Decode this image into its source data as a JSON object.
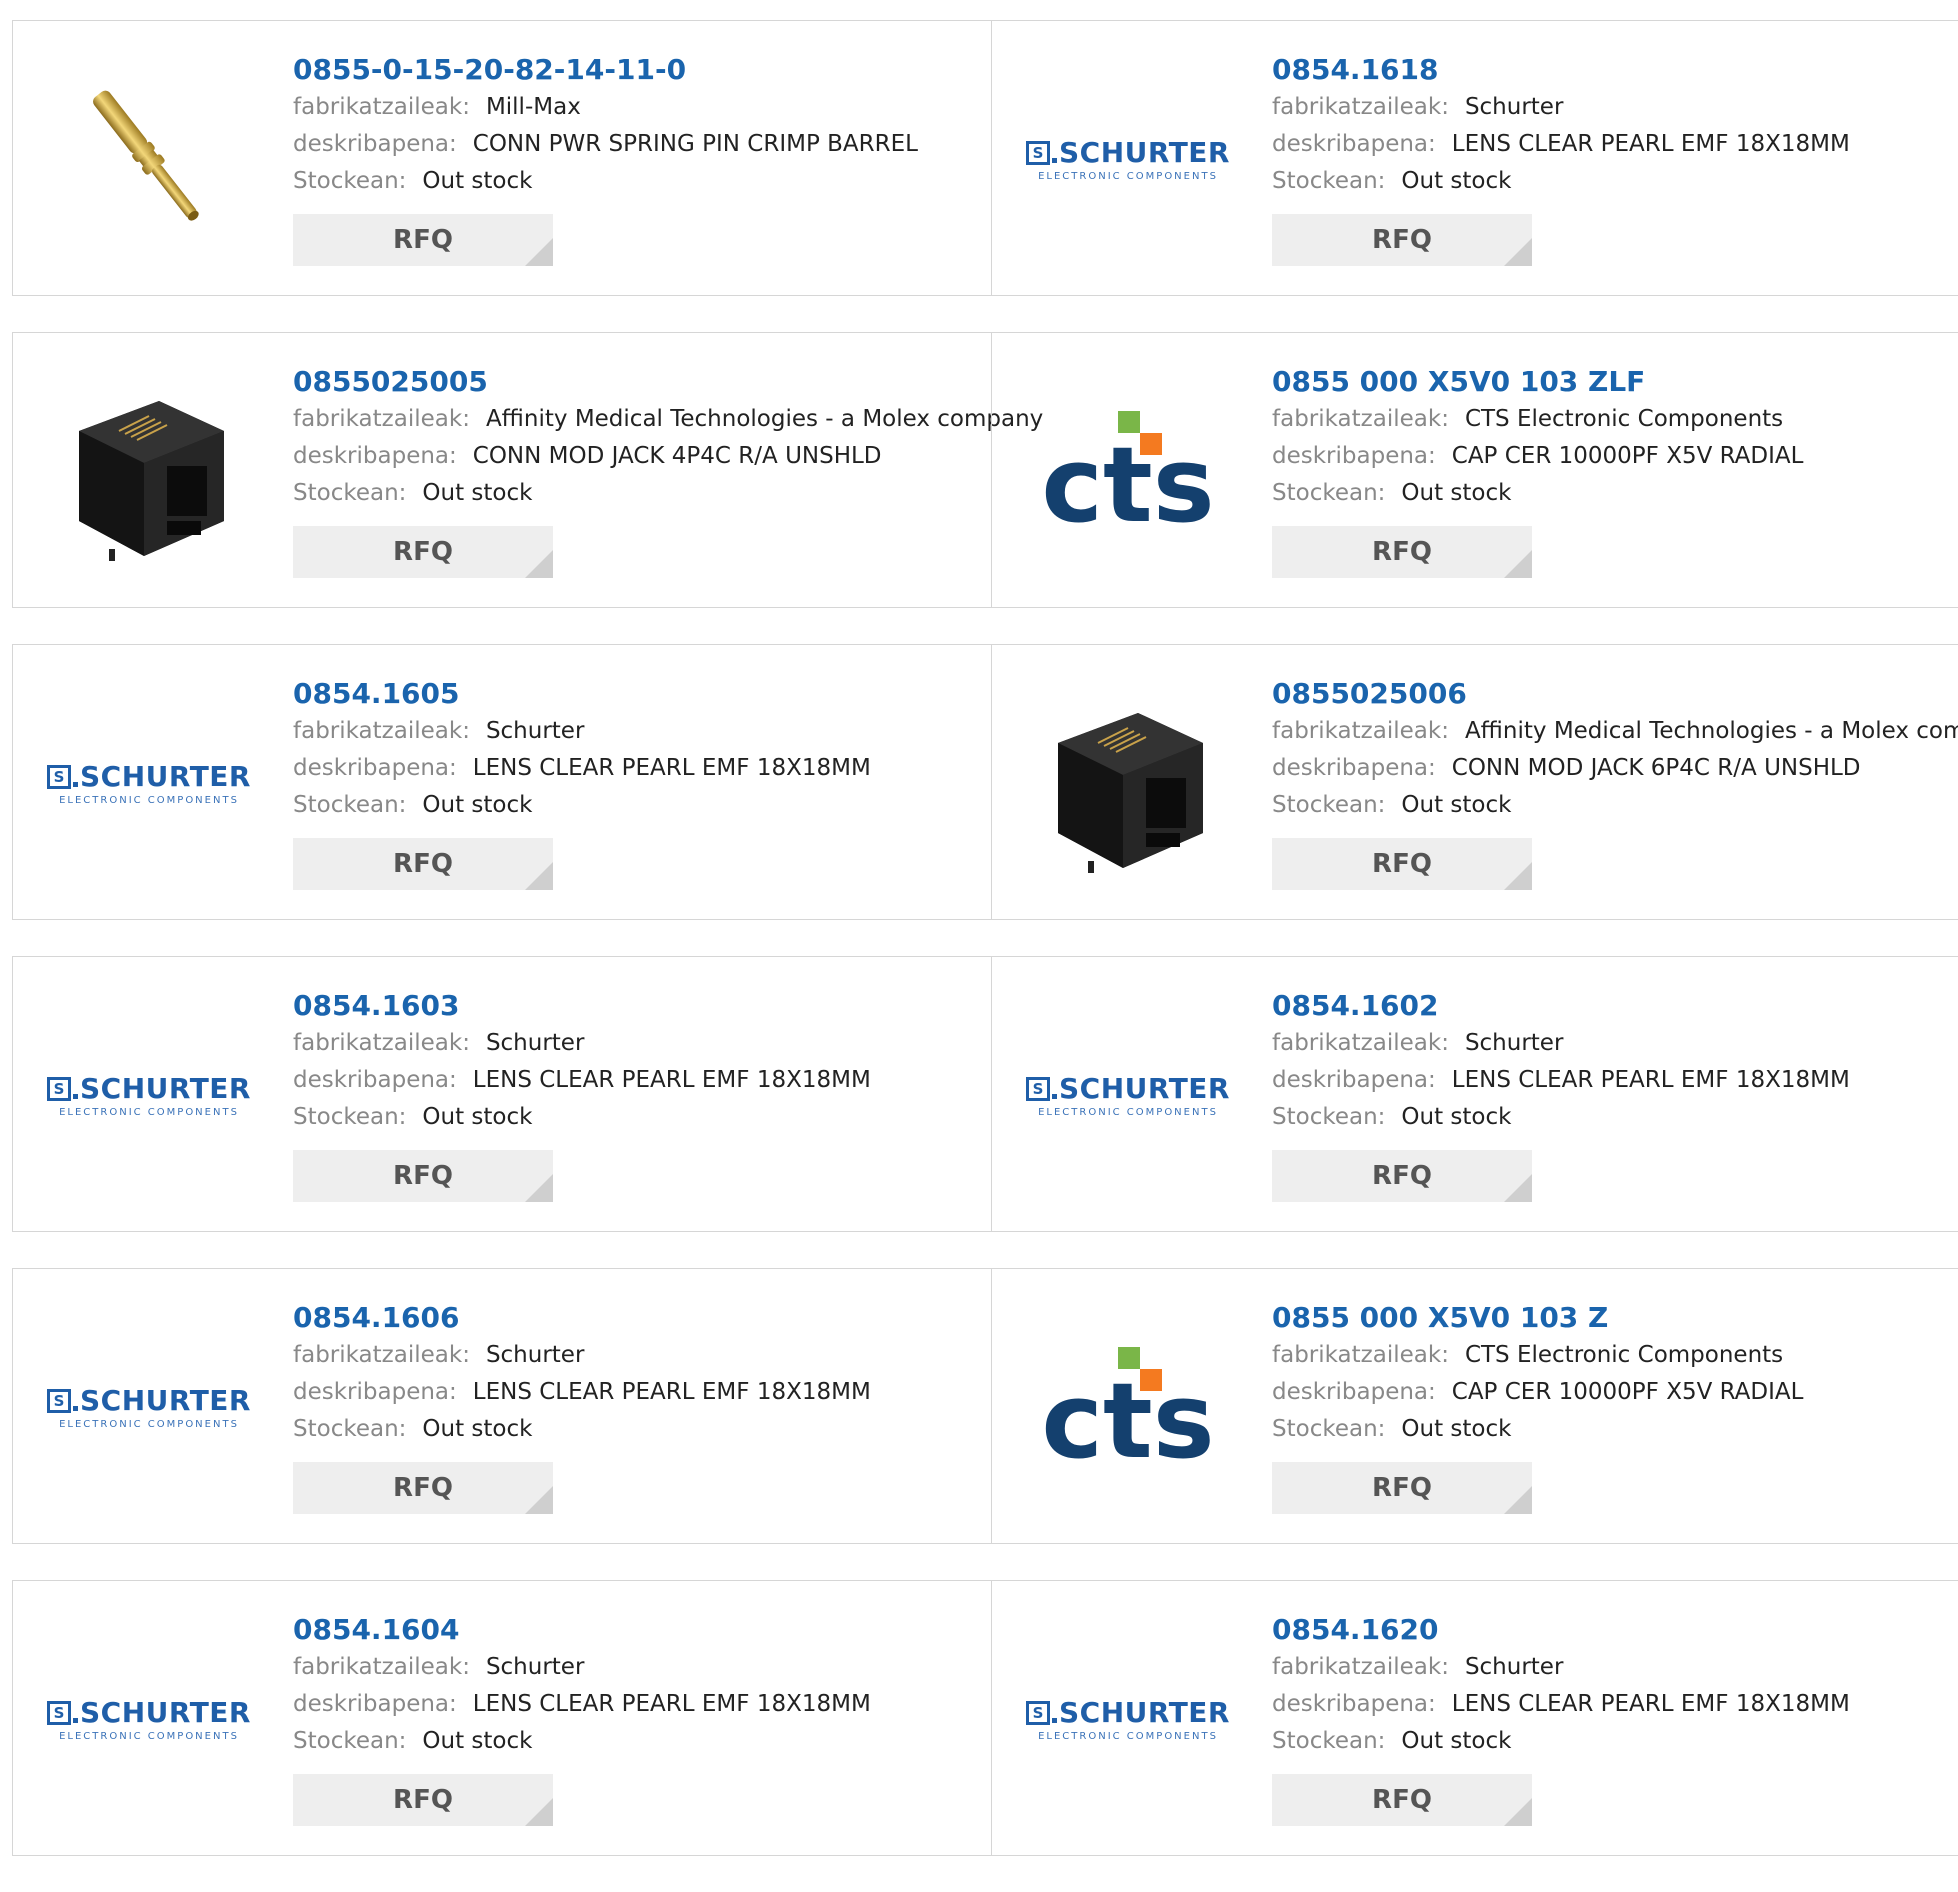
{
  "labels": {
    "manufacturer": "fabrikatzaileak",
    "description": "deskribapena",
    "stock": "Stockean",
    "rfq": "RFQ"
  },
  "logos": {
    "schurter_word": "SCHURTER",
    "schurter_sub": "ELECTRONIC COMPONENTS",
    "schurter_mark": "S",
    "cts_word": "cts"
  },
  "colors": {
    "part_link": "#1a64ad",
    "schurter_blue": "#1f5ea8",
    "cts_navy": "#14406e",
    "cts_green": "#7ab648",
    "cts_orange": "#f47a20",
    "rfq_bg": "#eeeeee"
  },
  "products": [
    {
      "part": "0855-0-15-20-82-14-11-0",
      "manufacturer": "Mill-Max",
      "description": "CONN PWR SPRING PIN CRIMP BARREL",
      "stock": "Out stock",
      "image": "spring-pin-photo"
    },
    {
      "part": "0854.1618",
      "manufacturer": "Schurter",
      "description": "LENS CLEAR PEARL EMF 18X18MM",
      "stock": "Out stock",
      "image": "schurter-logo"
    },
    {
      "part": "0855025005",
      "manufacturer": "Affinity Medical Technologies - a Molex company",
      "description": "CONN MOD JACK 4P4C R/A UNSHLD",
      "stock": "Out stock",
      "image": "modular-jack-photo"
    },
    {
      "part": "0855 000 X5V0 103 ZLF",
      "manufacturer": "CTS Electronic Components",
      "description": "CAP CER 10000PF X5V RADIAL",
      "stock": "Out stock",
      "image": "cts-logo"
    },
    {
      "part": "0854.1605",
      "manufacturer": "Schurter",
      "description": "LENS CLEAR PEARL EMF 18X18MM",
      "stock": "Out stock",
      "image": "schurter-logo"
    },
    {
      "part": "0855025006",
      "manufacturer": "Affinity Medical Technologies - a Molex company",
      "description": "CONN MOD JACK 6P4C R/A UNSHLD",
      "stock": "Out stock",
      "image": "modular-jack-photo"
    },
    {
      "part": "0854.1603",
      "manufacturer": "Schurter",
      "description": "LENS CLEAR PEARL EMF 18X18MM",
      "stock": "Out stock",
      "image": "schurter-logo"
    },
    {
      "part": "0854.1602",
      "manufacturer": "Schurter",
      "description": "LENS CLEAR PEARL EMF 18X18MM",
      "stock": "Out stock",
      "image": "schurter-logo"
    },
    {
      "part": "0854.1606",
      "manufacturer": "Schurter",
      "description": "LENS CLEAR PEARL EMF 18X18MM",
      "stock": "Out stock",
      "image": "schurter-logo"
    },
    {
      "part": "0855 000 X5V0 103 Z",
      "manufacturer": "CTS Electronic Components",
      "description": "CAP CER 10000PF X5V RADIAL",
      "stock": "Out stock",
      "image": "cts-logo"
    },
    {
      "part": "0854.1604",
      "manufacturer": "Schurter",
      "description": "LENS CLEAR PEARL EMF 18X18MM",
      "stock": "Out stock",
      "image": "schurter-logo"
    },
    {
      "part": "0854.1620",
      "manufacturer": "Schurter",
      "description": "LENS CLEAR PEARL EMF 18X18MM",
      "stock": "Out stock",
      "image": "schurter-logo"
    }
  ]
}
